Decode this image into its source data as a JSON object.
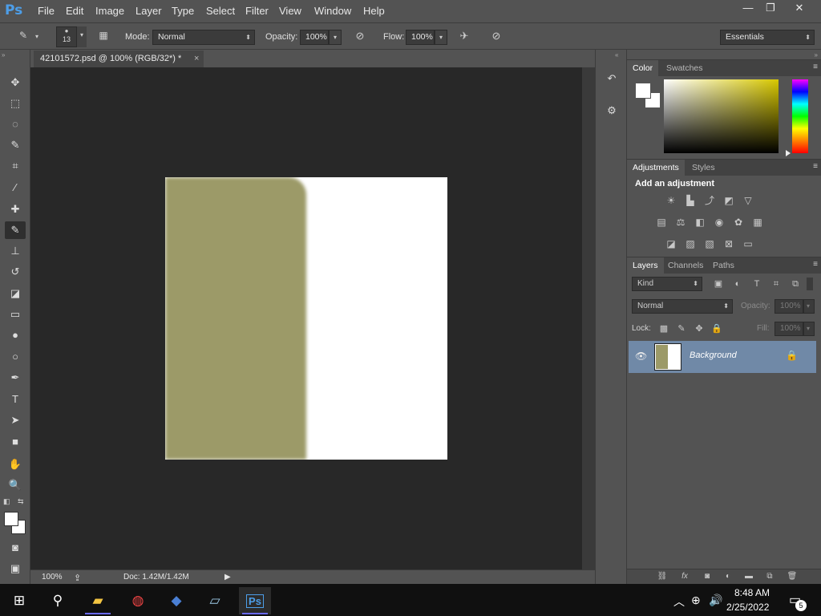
{
  "app": {
    "logo": "Ps",
    "menu": [
      "File",
      "Edit",
      "Image",
      "Layer",
      "Type",
      "Select",
      "Filter",
      "View",
      "Window",
      "Help"
    ],
    "window_controls": {
      "minimize": "—",
      "restore": "❐",
      "close": "✕"
    }
  },
  "options_bar": {
    "brush_size": "13",
    "mode_label": "Mode:",
    "mode_value": "Normal",
    "opacity_label": "Opacity:",
    "opacity_value": "100%",
    "flow_label": "Flow:",
    "flow_value": "100%",
    "workspace": "Essentials"
  },
  "document": {
    "tab_title": "42101572.psd @ 100% (RGB/32*) *",
    "close_glyph": "×",
    "zoom": "100%",
    "doc_info": "Doc: 1.42M/1.42M",
    "canvas_colors": {
      "background": "#ffffff",
      "shape": "#9c9a68"
    }
  },
  "tools": [
    {
      "name": "move-tool",
      "glyph": "✥"
    },
    {
      "name": "marquee-tool",
      "glyph": "⬚"
    },
    {
      "name": "lasso-tool",
      "glyph": "◌"
    },
    {
      "name": "quick-selection-tool",
      "glyph": "✎"
    },
    {
      "name": "crop-tool",
      "glyph": "⌗"
    },
    {
      "name": "eyedropper-tool",
      "glyph": "⁄"
    },
    {
      "name": "healing-brush-tool",
      "glyph": "✚"
    },
    {
      "name": "brush-tool",
      "glyph": "✎"
    },
    {
      "name": "clone-stamp-tool",
      "glyph": "⊥"
    },
    {
      "name": "history-brush-tool",
      "glyph": "↺"
    },
    {
      "name": "eraser-tool",
      "glyph": "◪"
    },
    {
      "name": "gradient-tool",
      "glyph": "▭"
    },
    {
      "name": "blur-tool",
      "glyph": "●"
    },
    {
      "name": "dodge-tool",
      "glyph": "○"
    },
    {
      "name": "pen-tool",
      "glyph": "✒"
    },
    {
      "name": "type-tool",
      "glyph": "T"
    },
    {
      "name": "path-selection-tool",
      "glyph": "➤"
    },
    {
      "name": "rectangle-tool",
      "glyph": "■"
    },
    {
      "name": "hand-tool",
      "glyph": "✋"
    },
    {
      "name": "zoom-tool",
      "glyph": "🔍"
    }
  ],
  "panels": {
    "color": {
      "tabs": [
        "Color",
        "Swatches"
      ],
      "active_tab": "Color"
    },
    "adjustments": {
      "tabs": [
        "Adjustments",
        "Styles"
      ],
      "active_tab": "Adjustments",
      "heading": "Add an adjustment"
    },
    "layers": {
      "tabs": [
        "Layers",
        "Channels",
        "Paths"
      ],
      "active_tab": "Layers",
      "filter_kind": "Kind",
      "blend_mode": "Normal",
      "opacity_label": "Opacity:",
      "opacity_value": "100%",
      "lock_label": "Lock:",
      "fill_label": "Fill:",
      "fill_value": "100%",
      "layer_name": "Background"
    }
  },
  "taskbar": {
    "time": "8:48 AM",
    "date": "2/25/2022",
    "notification_count": "5"
  }
}
